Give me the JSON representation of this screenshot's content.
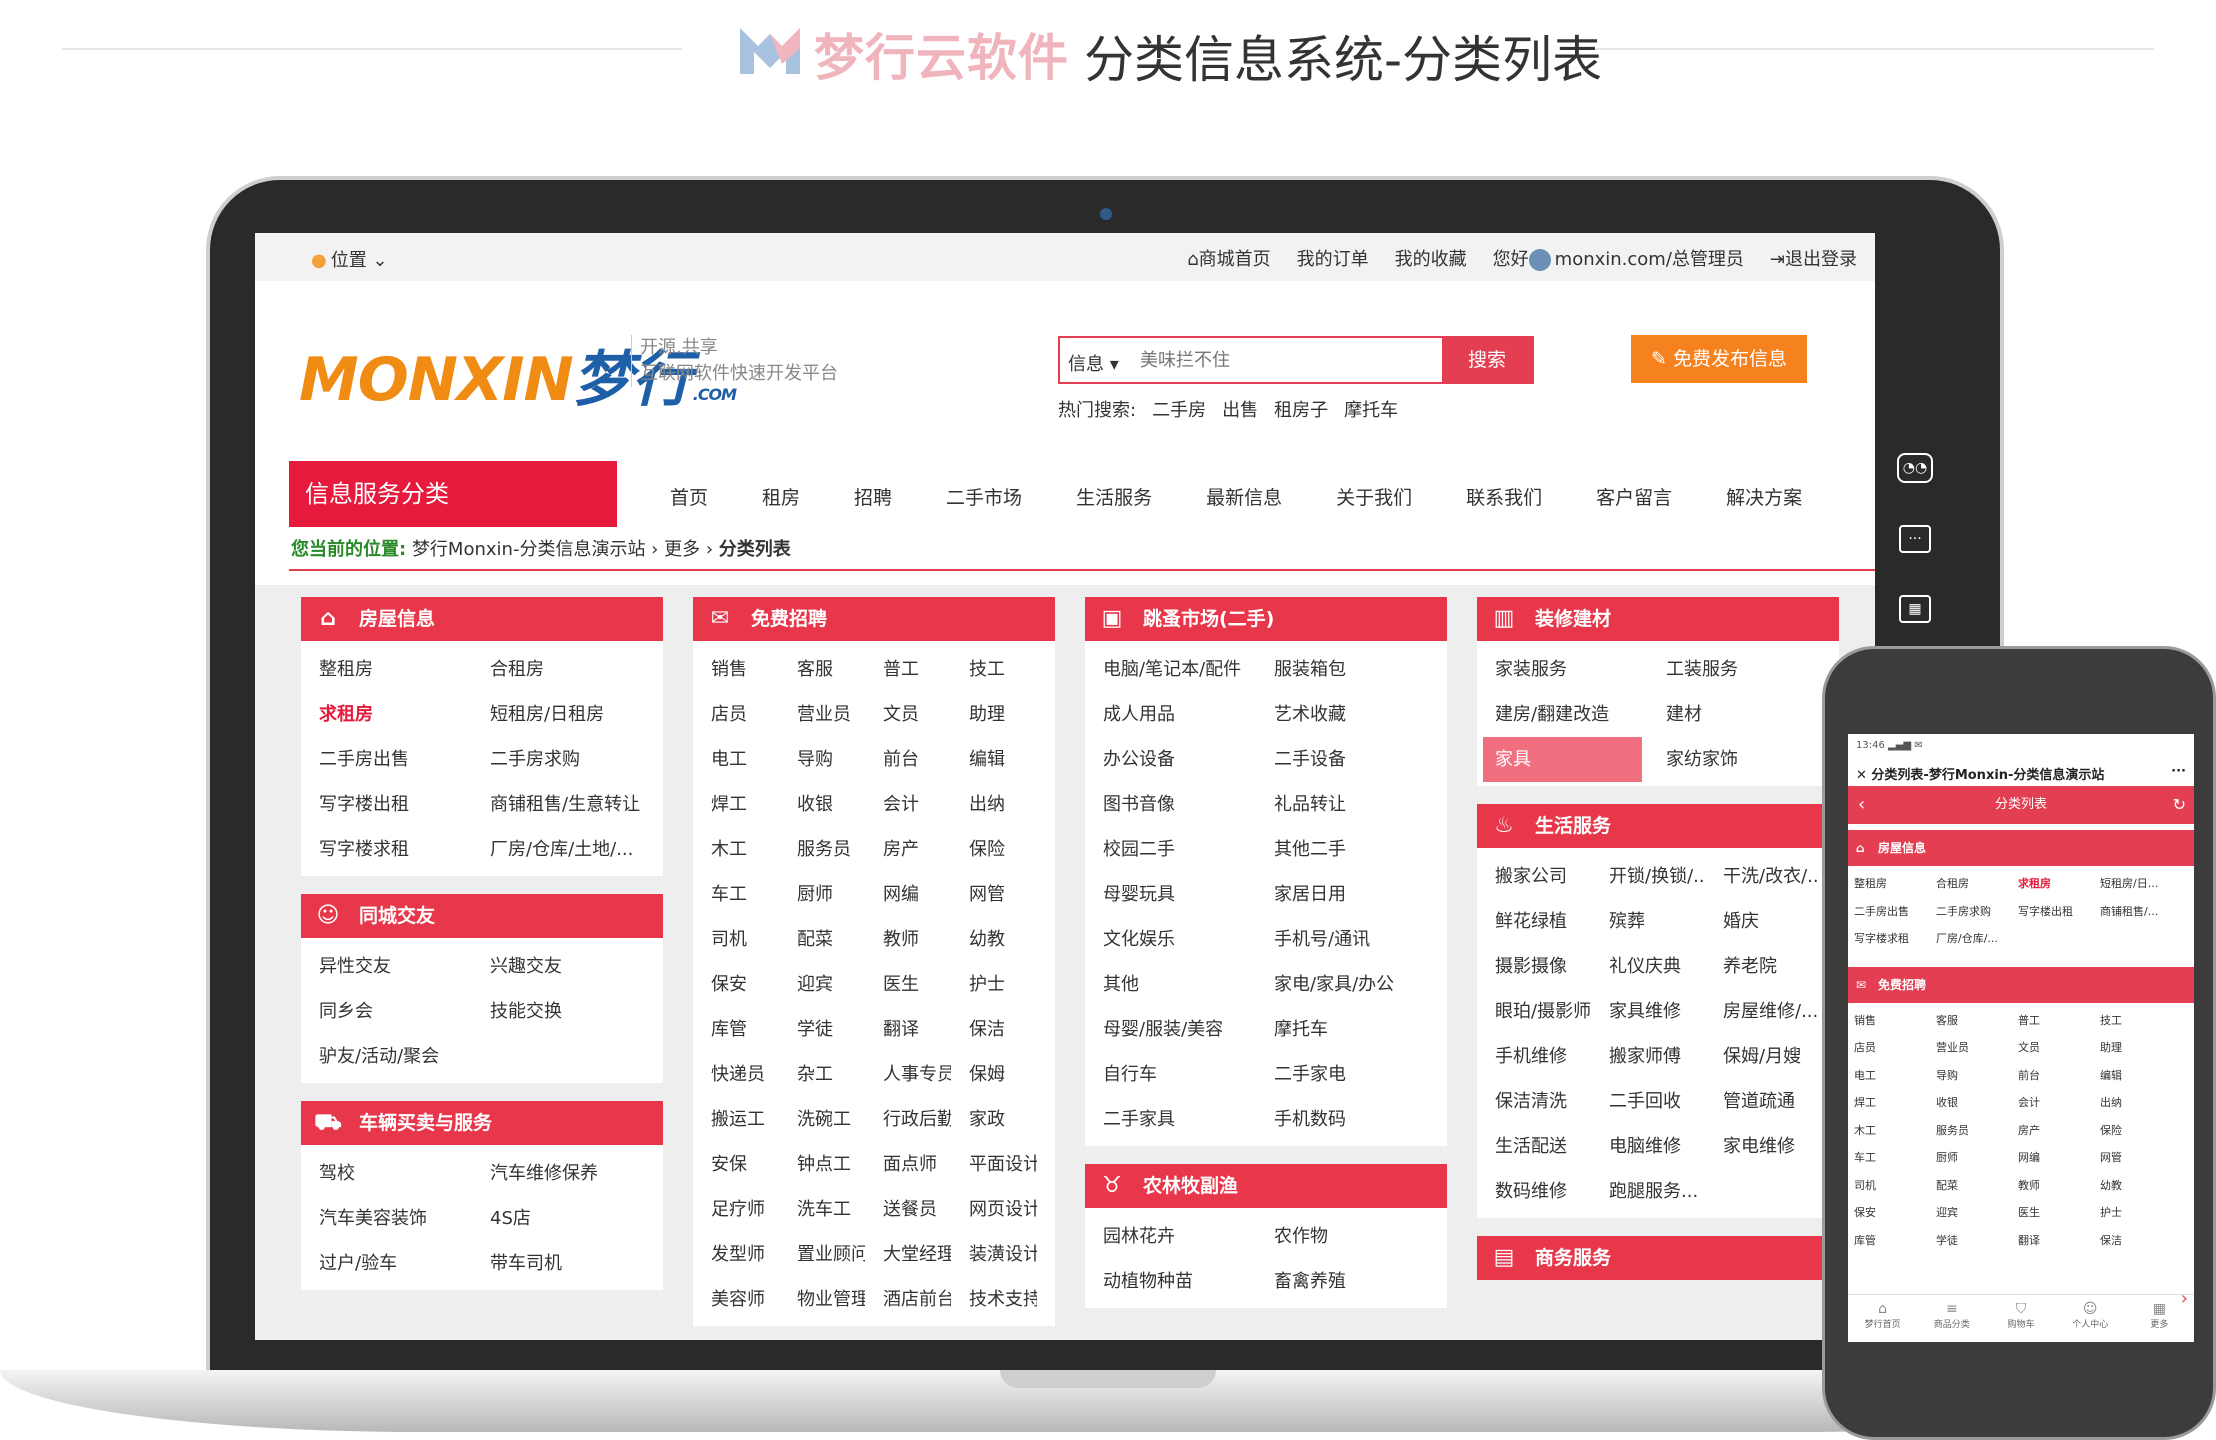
{
  "header": {
    "brand": "梦行云软件",
    "title": "分类信息系统-分类列表"
  },
  "topbar": {
    "location_icon": "pin-icon",
    "location_label": "位置",
    "links": [
      "商城首页",
      "我的订单",
      "我的收藏"
    ],
    "greeting": "您好",
    "user": "monxin.com/总管理员",
    "logout": "退出登录"
  },
  "site": {
    "logo_main": "MONXIN",
    "logo_cn": "梦行",
    "logo_sub": ".COM",
    "slogan_1": "开源.共享",
    "slogan_2": "互联网软件快速开发平台",
    "search_category": "信息",
    "search_placeholder": "美味拦不住",
    "search_button": "搜索",
    "publish_button": "免费发布信息",
    "hot_label": "热门搜索:",
    "hot_terms": [
      "二手房",
      "出售",
      "租房子",
      "摩托车"
    ],
    "category_box": "信息服务分类",
    "nav": [
      "首页",
      "租房",
      "招聘",
      "二手市场",
      "生活服务",
      "最新信息",
      "关于我们",
      "联系我们",
      "客户留言",
      "解决方案"
    ],
    "breadcrumb_label": "您当前的位置:",
    "breadcrumb_site": "梦行Monxin-分类信息演示站",
    "breadcrumb_more": "更多",
    "breadcrumb_current": "分类列表"
  },
  "categories": {
    "house": {
      "title": "房屋信息",
      "items": [
        "整租房",
        "合租房",
        "求租房",
        "短租房/日租房",
        "二手房出售",
        "二手房求购",
        "写字楼出租",
        "商铺租售/生意转让",
        "写字楼求租",
        "厂房/仓库/土地/..."
      ]
    },
    "friends": {
      "title": "同城交友",
      "items": [
        "异性交友",
        "兴趣交友",
        "同乡会",
        "技能交换",
        "驴友/活动/聚会"
      ]
    },
    "vehicle": {
      "title": "车辆买卖与服务",
      "items": [
        "驾校",
        "汽车维修保养",
        "汽车美容装饰",
        "4S店",
        "过户/验车",
        "带车司机"
      ]
    },
    "jobs": {
      "title": "免费招聘",
      "items": [
        "销售",
        "客服",
        "普工",
        "技工",
        "店员",
        "营业员",
        "文员",
        "助理",
        "电工",
        "导购",
        "前台",
        "编辑",
        "焊工",
        "收银",
        "会计",
        "出纳",
        "木工",
        "服务员",
        "房产",
        "保险",
        "车工",
        "厨师",
        "网编",
        "网管",
        "司机",
        "配菜",
        "教师",
        "幼教",
        "保安",
        "迎宾",
        "医生",
        "护士",
        "库管",
        "学徒",
        "翻译",
        "保洁",
        "快递员",
        "杂工",
        "人事专员",
        "保姆",
        "搬运工",
        "洗碗工",
        "行政后勤",
        "家政",
        "安保",
        "钟点工",
        "面点师",
        "平面设计",
        "足疗师",
        "洗车工",
        "送餐员",
        "网页设计",
        "发型师",
        "置业顾问",
        "大堂经理",
        "装潢设计",
        "美容师",
        "物业管理",
        "酒店前台",
        "技术支持"
      ]
    },
    "flea": {
      "title": "跳蚤市场(二手)",
      "items": [
        "电脑/笔记本/配件",
        "服装箱包",
        "成人用品",
        "艺术收藏",
        "办公设备",
        "二手设备",
        "图书音像",
        "礼品转让",
        "校园二手",
        "其他二手",
        "母婴玩具",
        "家居日用",
        "文化娱乐",
        "手机号/通讯",
        "其他",
        "家电/家具/办公",
        "母婴/服装/美容",
        "摩托车",
        "自行车",
        "二手家电",
        "二手家具",
        "手机数码"
      ]
    },
    "farm": {
      "title": "农林牧副渔",
      "items": [
        "园林花卉",
        "农作物",
        "动植物种苗",
        "畜禽养殖"
      ]
    },
    "decor": {
      "title": "装修建材",
      "items": [
        "家装服务",
        "工装服务",
        "建房/翻建改造",
        "建材",
        "家具",
        "家纺家饰"
      ]
    },
    "life": {
      "title": "生活服务",
      "items": [
        "搬家公司",
        "开锁/换锁/...",
        "干洗/改衣/...",
        "鲜花绿植",
        "殡葬",
        "婚庆",
        "摄影摄像",
        "礼仪庆典",
        "养老院",
        "眼珀/摄影师",
        "家具维修",
        "房屋维修/...",
        "手机维修",
        "搬家师傅",
        "保姆/月嫂",
        "保洁清洗",
        "二手回收",
        "管道疏通",
        "生活配送",
        "电脑维修",
        "家电维修",
        "数码维修",
        "跑腿服务..."
      ]
    },
    "business": {
      "title": "商务服务"
    }
  },
  "phone": {
    "status_time": "13:46",
    "page_title": "分类列表-梦行Monxin-分类信息演示站",
    "bar_title": "分类列表",
    "house": {
      "title": "房屋信息",
      "items": [
        "整租房",
        "合租房",
        "求租房",
        "短租房/日...",
        "二手房出售",
        "二手房求购",
        "写字楼出租",
        "商铺租售/...",
        "写字楼求租",
        "厂房/仓库/..."
      ]
    },
    "jobs": {
      "title": "免费招聘",
      "items": [
        "销售",
        "客服",
        "普工",
        "技工",
        "店员",
        "营业员",
        "文员",
        "助理",
        "电工",
        "导购",
        "前台",
        "编辑",
        "焊工",
        "收银",
        "会计",
        "出纳",
        "木工",
        "服务员",
        "房产",
        "保险",
        "车工",
        "厨师",
        "网编",
        "网管",
        "司机",
        "配菜",
        "教师",
        "幼教",
        "保安",
        "迎宾",
        "医生",
        "护士",
        "库管",
        "学徒",
        "翻译",
        "保洁"
      ]
    },
    "tabs": [
      "梦行首页",
      "商品分类",
      "购物车",
      "个人中心",
      "更多"
    ]
  },
  "colors": {
    "accent": "#e33e52",
    "brand_orange": "#f08c14",
    "brand_blue": "#1e5fa8"
  }
}
